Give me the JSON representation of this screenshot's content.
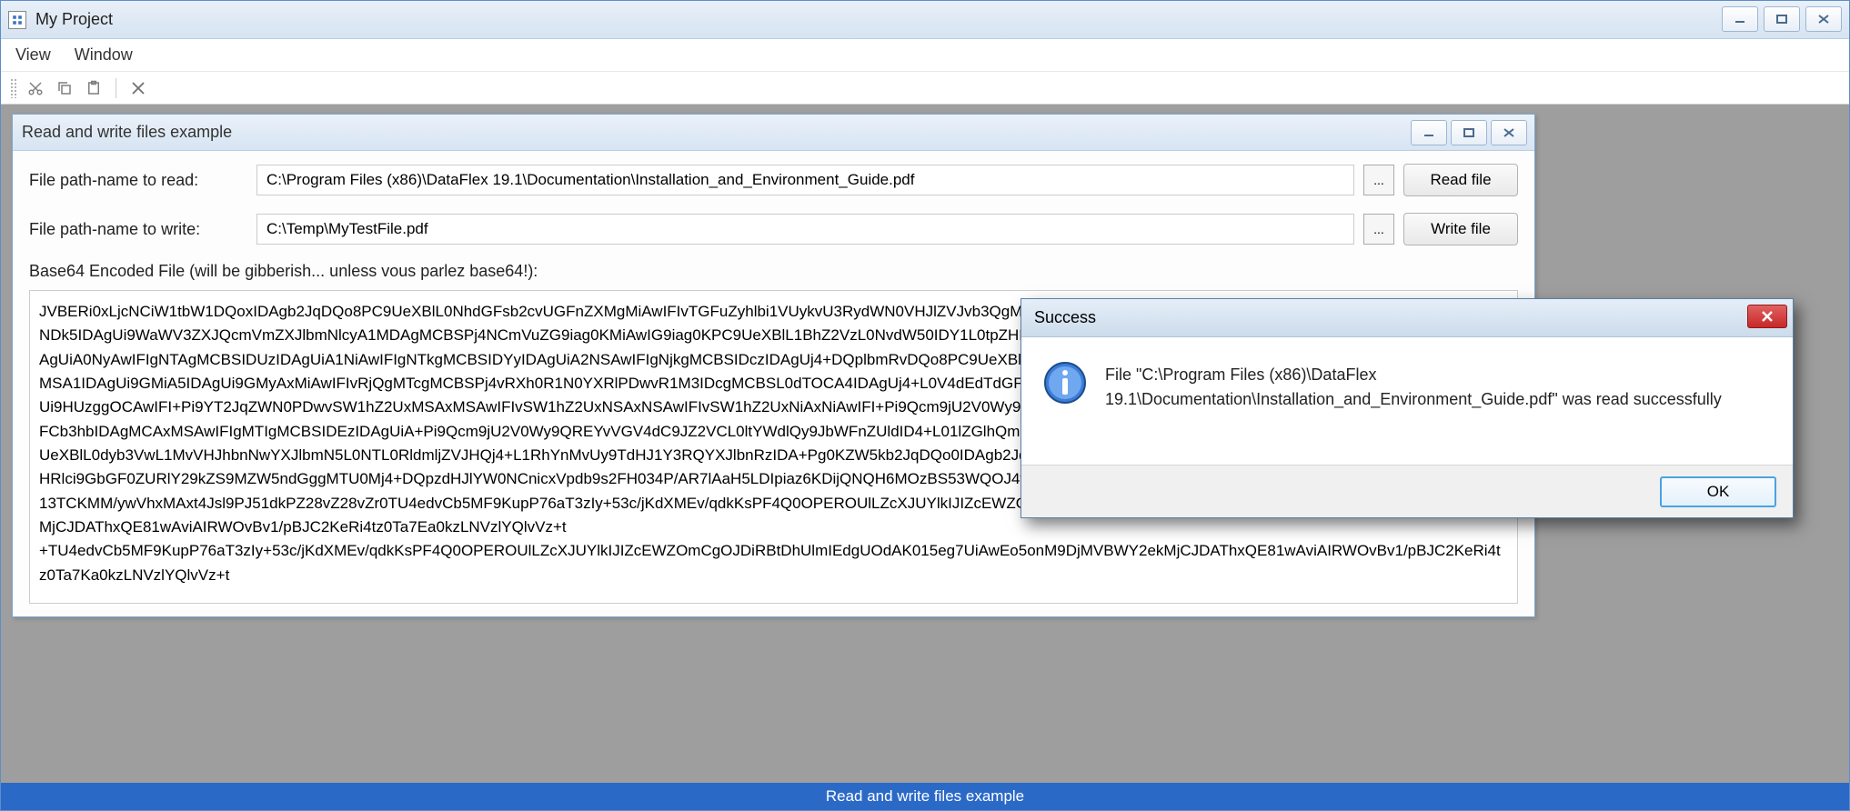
{
  "app": {
    "title": "My Project"
  },
  "menubar": {
    "items": [
      "View",
      "Window"
    ]
  },
  "child": {
    "title": "Read and write files example",
    "read_label": "File path-name to read:",
    "read_path": "C:\\Program Files (x86)\\DataFlex 19.1\\Documentation\\Installation_and_Environment_Guide.pdf",
    "browse_btn": "...",
    "read_btn": "Read file",
    "write_label": "File path-name to write:",
    "write_path": "C:\\Temp\\MyTestFile.pdf",
    "write_btn": "Write file",
    "output_label": "Base64 Encoded File (will be gibberish... unless vous parlez base64!):",
    "output": "JVBERi0xLjcNCiW1tbW1DQoxIDAgb2JqDQo8PC9UeXBlL0NhdGFsb2cvUGFnZXMgMiAwIFIvTGFuZyhlbi1VUykvU3RydWN0VHJlZVJvb3QgMTIzMiAwIFIvTWFya0lmbzw8L01hcmtlZCB0cnVlPj4vTWV0YWRhdGEgNDk5IDAgUi9WaWV3ZXJQcmVmZXJlbmNlcyA1MDAgMCBSPj4NCmVuZG9iag0KMiAwIG9iag0KPC9UeXBlL1BhZ2VzL0NvdW50IDY1L0tpZHNbMyAwIFIgMzAgMCBSIDMzIDAgUiAzNyAwIFIgNDEgMCBSIDQ0IDAgUiA0NyAwIFIgNTAgMCBSIDUzIDAgUiA1NiAwIFIgNTkgMCBSIDYyIDAgUiA2NSAwIFIgNjkgMCBSIDczIDAgUj4+DQplbmRvDQo8PC9UeXBlL1BhZ2UvUGFyZW50IDIgMCBSL1Jlc291cmNlczw8L0ZvbnQ8PC9GMSA1IDAgUi9GMiA5IDAgUi9GMyAxMiAwIFIvRjQgMTcgMCBSPj4vRXh0R1N0YXRlPDwvR1M3IDcgMCBSL0dTOCA4IDAgUj4+L0V4dEdTdGF0ZTw8L0dTNyA3IDAgUj4+Pj4NL0V4dEdTdGF0ZTw8L0dTNyA3IDAgUi9HUzggOCAwIFI+Pi9YT2JqZWN0PDwvSW1hZ2UxMSAxMSAwIFIvSW1hZ2UxNSAxNSAwIFIvSW1hZ2UxNiAxNiAwIFI+Pi9Qcm9jU2V0Wy9QREYvVGV4dC9JbWFnZUIvSW1hZ2VDL0ltYWdlSV0gPj4vTWVkaWFCb3hbIDAgMCAxMSAwIFIgMTIgMCBSIDEzIDAgUiA+Pi9Qcm9jU2V0Wy9QREYvVGV4dC9JZ2VCL0ltYWdlQy9JbWFnZUldID4+L01lZGlhQm94WyAwIDAgNjEyIDc5Ml0vQ29udGVudHMgNCAwIFIvR3JvdXA8PC9UeXBlL0dyb3VwL1MvVHJhbnNwYXJlbmN5L0NTL0RldmljZVJHQj4+L1RhYnMvUy9TdHJ1Y3RQYXJlbnRzIDA+Pg0KZW5kb2JqDQo0IDAgb2JqDFBhcmVudHMgMD4+DQplbmRvYmoNCjQgMCBvYmoNCjw8L0ZpbHRlci9GbGF0ZURlY29kZS9MZW5ndGggMTU0Mj4+DQpzdHJlYW0NCnicxVpdb9s2FH034P/AR7lAaH5LDIpiaz6KDijQNQH6MOzBS53WQOJ4ttrt5+9eSk5lU6JIWesCWLElX5/Dy8PDS4lk/pG8fj3/cPH+krA3b8jbywvy13TCKMM/ywVhxMAxt4Jsl9PJ51dkPZ28vZ28vZr0TU4edvCb5MF9KupP76aT3zIy+53c/jKdXMEv/qdkKsPF4Q0OPEROUlLZcXJUYlkIJIZcEWZOmCgOJDiRBtDhUlmIEdgUOdAK015eg7UiAwEo5onM9DjMVBWY2ekMjCJDAThxQE81wAviAIRWOvBv1/pBJC2KeRi4tz0Ta7Ea0kzLNVzlYQlvVz+t\n+TU4edvCb5MF9KupP76aT3zIy+53c/jKdXMEv/qdkKsPF4Q0OPEROUlLZcXJUYlkIJIZcEWZOmCgOJDiRBtDhUlmIEdgUOdAK015eg7UiAwEo5onM9DjMVBWY2ekMjCJDAThxQE81wAviAIRWOvBv1/pBJC2KeRi4tz0Ta7Ka0kzLNVzlYQlvVz+t"
  },
  "dialog": {
    "title": "Success",
    "text": "File \"C:\\Program Files (x86)\\DataFlex 19.1\\Documentation\\Installation_and_Environment_Guide.pdf\" was read successfully",
    "ok": "OK"
  },
  "status": {
    "text": "Read and write files example"
  }
}
